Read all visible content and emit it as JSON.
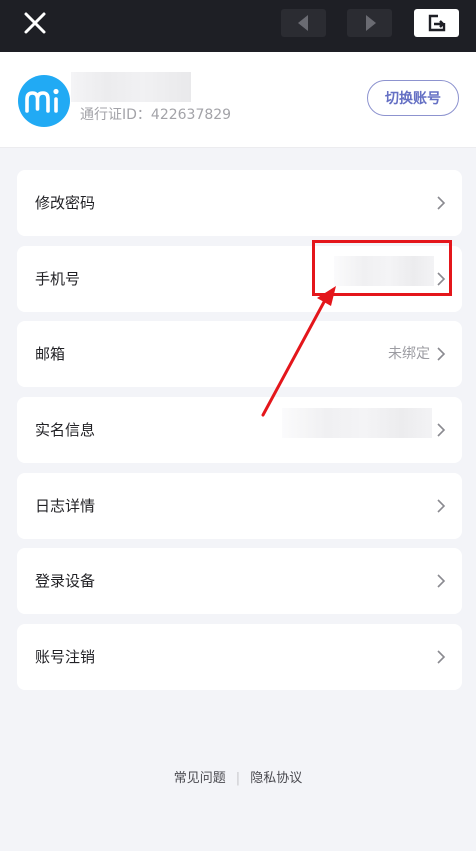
{
  "topbar": {
    "close_icon": "close-icon",
    "back_icon": "triangle-left-icon",
    "forward_icon": "triangle-right-icon",
    "external_icon": "open-external-icon"
  },
  "account": {
    "avatar_text": "mi",
    "uid_text": "通行证ID：422637829",
    "switch_label": "切换账号"
  },
  "menu": {
    "items": [
      {
        "label": "修改密码",
        "value": ""
      },
      {
        "label": "手机号",
        "value": ""
      },
      {
        "label": "邮箱",
        "value": "未绑定"
      },
      {
        "label": "实名信息",
        "value": ""
      },
      {
        "label": "日志详情",
        "value": ""
      },
      {
        "label": "登录设备",
        "value": ""
      },
      {
        "label": "账号注销",
        "value": ""
      }
    ]
  },
  "footer": {
    "faq": "常见问题",
    "separator": "|",
    "privacy": "隐私协议"
  },
  "colors": {
    "topbar": "#1e1f25",
    "accent": "#6570c4",
    "avatar": "#21aaf4",
    "annotation_red": "#e4161b"
  }
}
